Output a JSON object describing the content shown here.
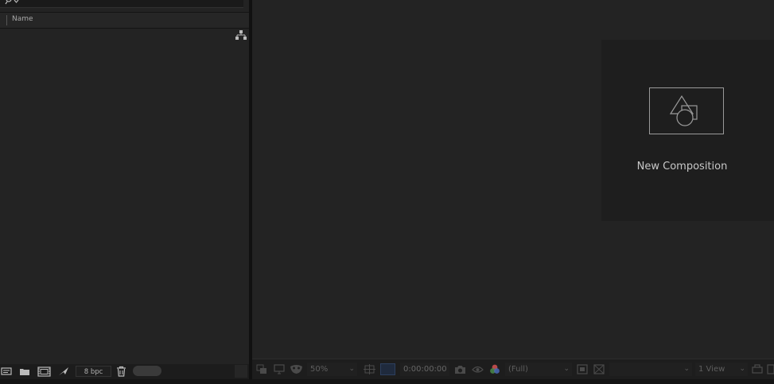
{
  "project_panel": {
    "column_header": "Name",
    "bit_depth": "8 bpc"
  },
  "composition_panel": {
    "new_composition_label": "New Composition"
  },
  "viewer_toolbar": {
    "magnification": "50%",
    "timecode": "0:00:00:00",
    "resolution": "(Full)",
    "view_layout": "1 View"
  }
}
